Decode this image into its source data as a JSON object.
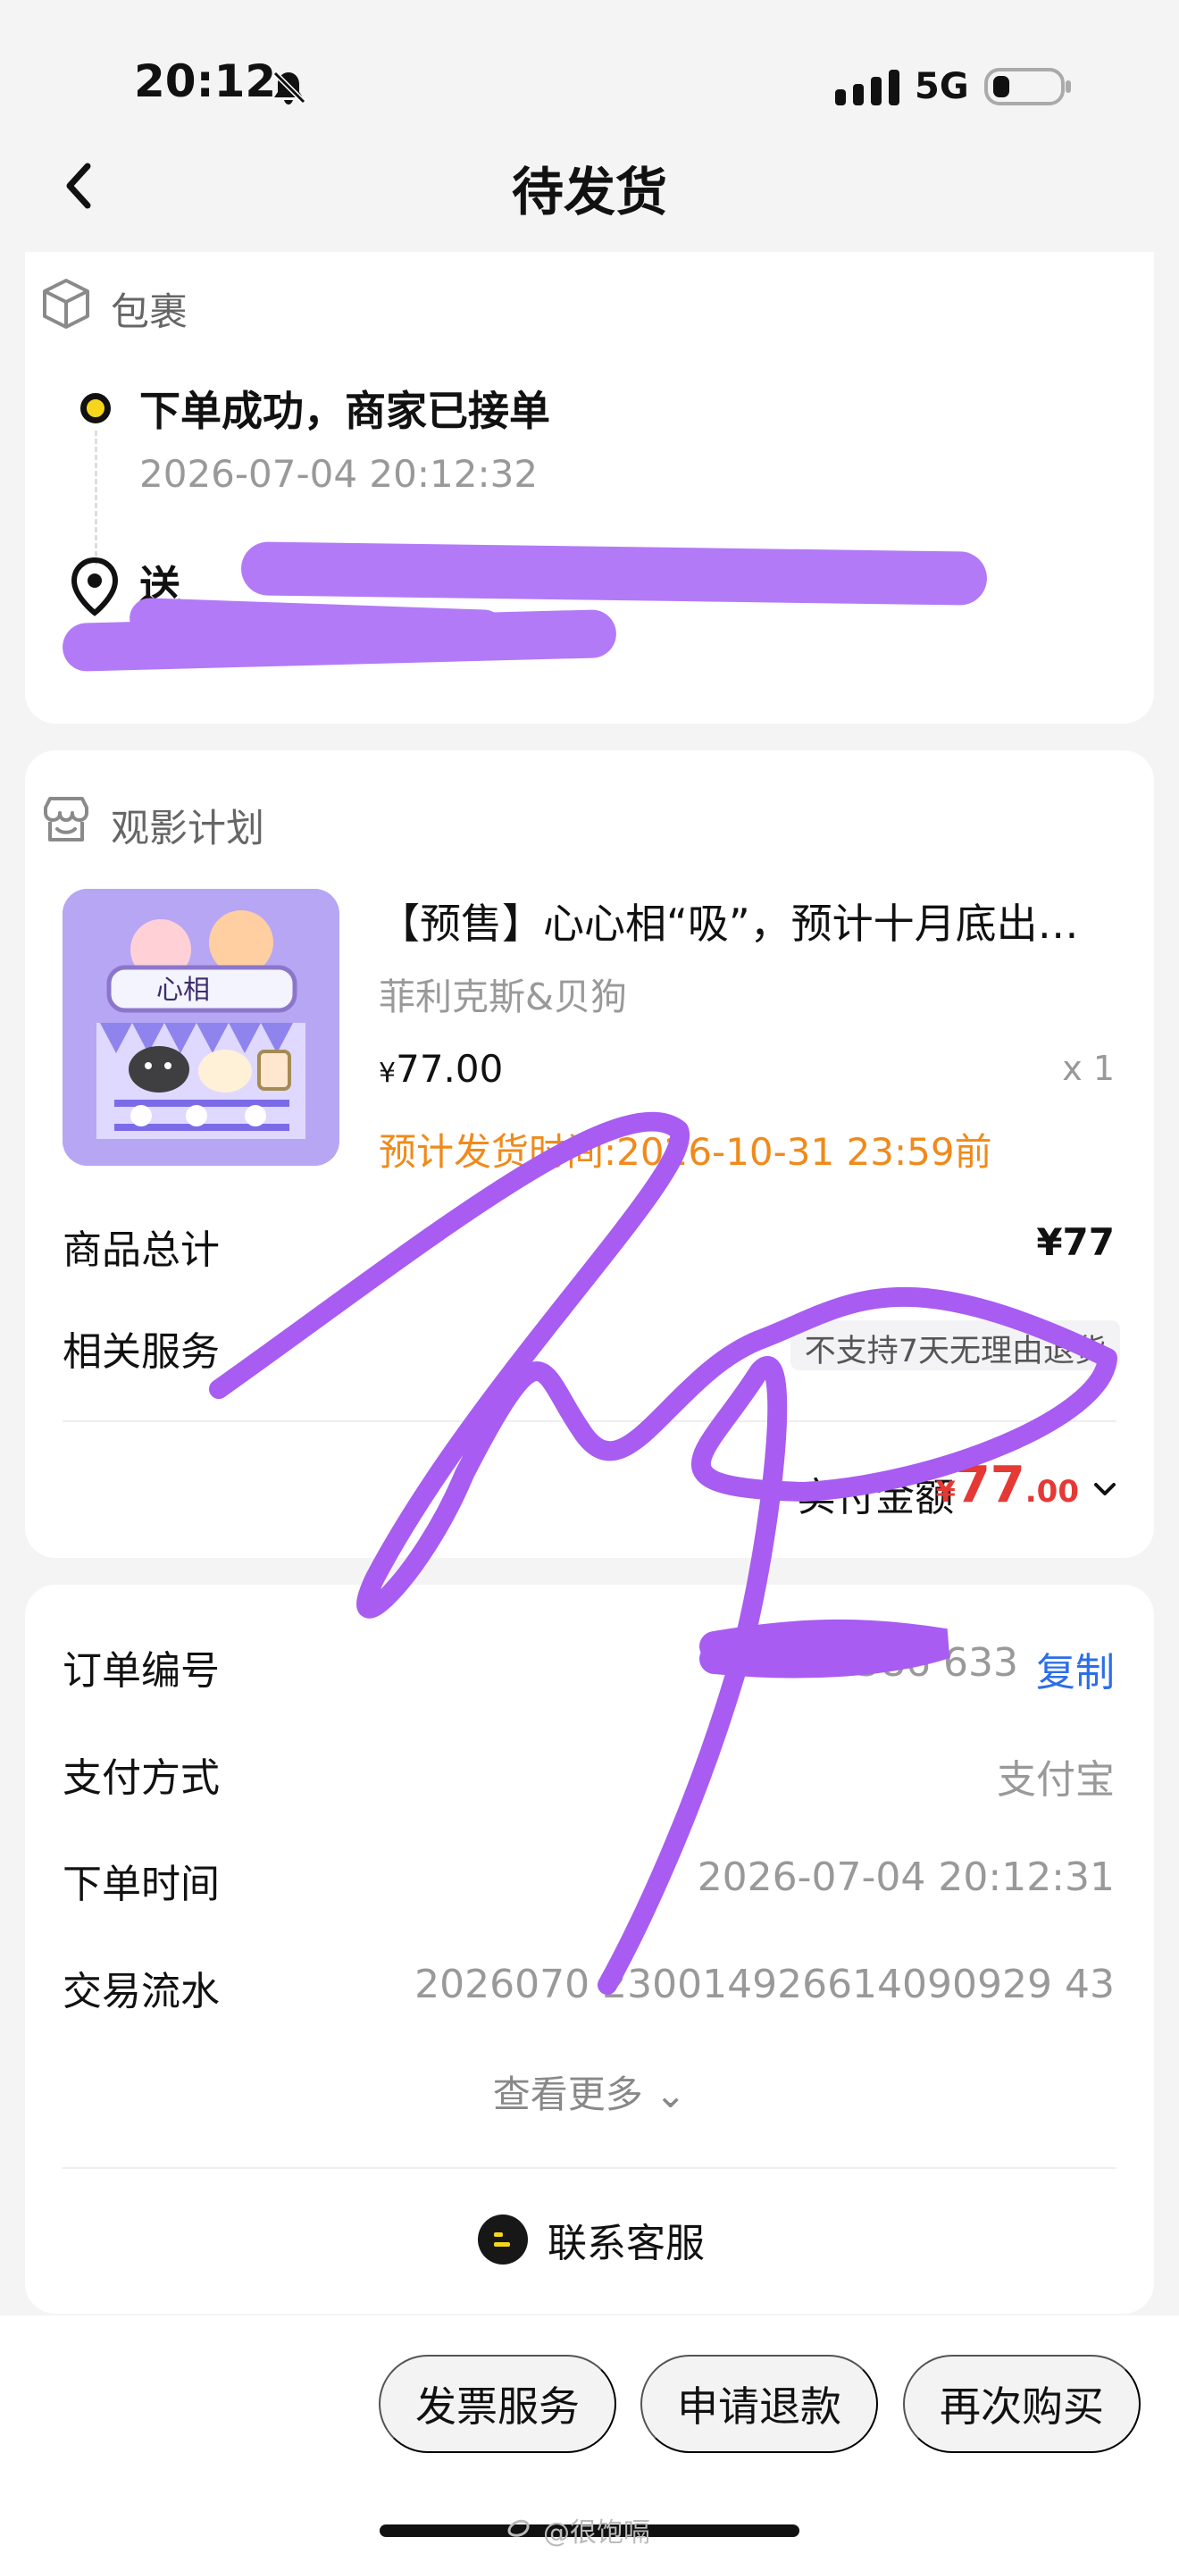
{
  "status_bar": {
    "time": "20:12",
    "network": "5G"
  },
  "header": {
    "title": "待发货"
  },
  "package": {
    "section_title": "包裹",
    "status": "下单成功，商家已接单",
    "status_time": "2026-07-04 20:12:32",
    "delivery_label": "送"
  },
  "goods": {
    "shop_name": "观影计划",
    "title": "【预售】心心相“吸”，预计十月底出…",
    "seller": "菲利克斯&贝狗",
    "price_symbol": "¥",
    "price": "77.00",
    "quantity": "x 1",
    "ship_time": "预计发货时间:2026-10-31 23:59前",
    "total_label": "商品总计",
    "total_value": "¥77",
    "service_label": "相关服务",
    "service_tag": "不支持7天无理由退货",
    "paid_label": "实付金额",
    "paid_symbol": "¥",
    "paid_int": "77",
    "paid_dec": ".00",
    "thumb_text": "心相"
  },
  "order": {
    "number_label": "订单编号",
    "number_value": "76586 633",
    "copy_label": "复制",
    "payment_label": "支付方式",
    "payment_value": "支付宝",
    "time_label": "下单时间",
    "time_value": "2026-07-04 20:12:31",
    "trade_label": "交易流水",
    "trade_value": "2026070 230014926614090929 43",
    "more_label": "查看更多",
    "contact_label": "联系客服"
  },
  "actions": {
    "invoice": "发票服务",
    "refund": "申请退款",
    "rebuy": "再次购买"
  },
  "watermark": "@很饱嗝"
}
